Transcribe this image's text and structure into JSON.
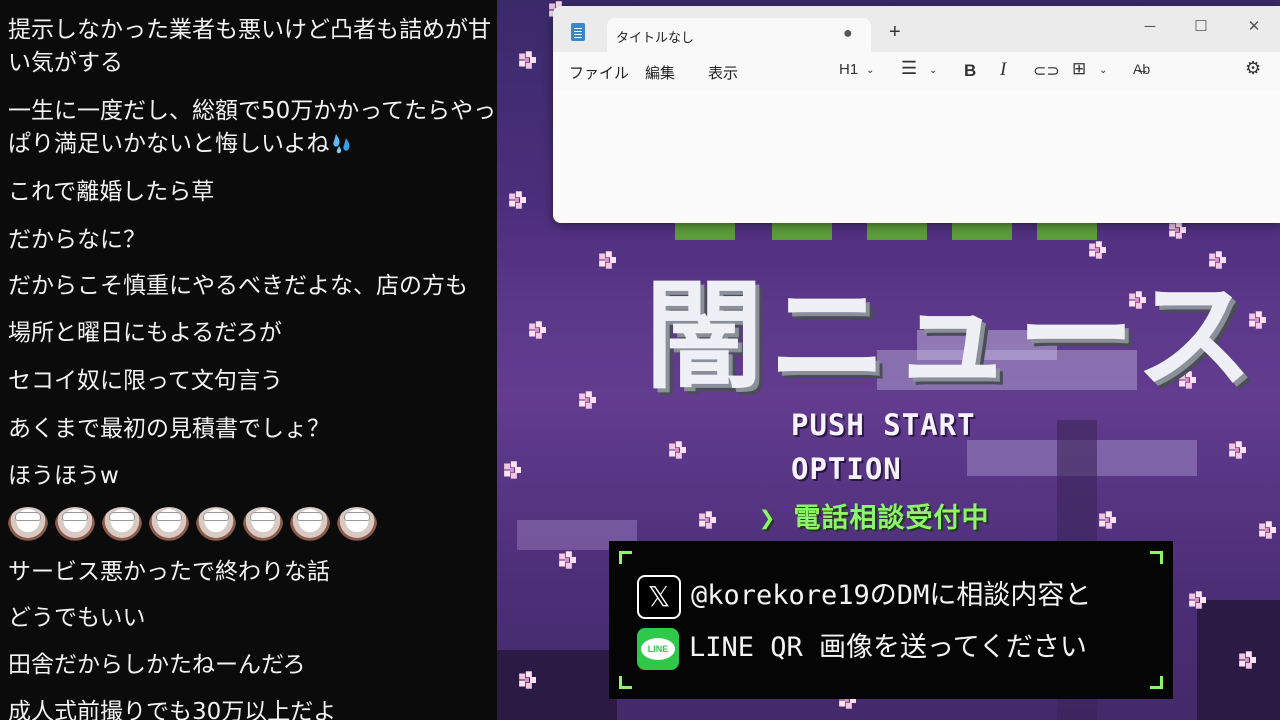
{
  "chat": {
    "messages": [
      "提示しなかった業者も悪いけど凸者も詰めが甘い気がする",
      "一生に一度だし、総額で50万かかってたらやっぱり満足いかないと悔しいよね",
      "これで離婚したら草",
      "だからなに？",
      "だからこそ慎重にやるべきだよな、店の方も",
      "場所と曜日にもよるだろが",
      "セコイ奴に限って文句言う",
      "あくまで最初の見積書でしょ？",
      "ほうほうw",
      "サービス悪かったで終わりな話",
      "どうでもいい",
      "田舎だからしかたねーんだろ",
      "成人式前撮りでも30万以上だよ"
    ],
    "stamp_count": 8,
    "stamp_icon": "emote-stamp-icon",
    "sweat_icon": "sweat-drops-icon"
  },
  "game": {
    "title": "闇ニュース",
    "menu": {
      "push_start": "PUSH START",
      "option": "OPTION",
      "selected": "電話相談受付中",
      "cursor": "❯"
    },
    "info": {
      "x_handle_line": "@korekore19のDMに相談内容と",
      "line_line": "LINE QR 画像を送ってください",
      "x_icon": "𝕏",
      "line_icon": "LINE"
    },
    "colors": {
      "accent": "#8ef56a",
      "bg": "#4d2f7d"
    }
  },
  "notepad": {
    "tab_title": "タイトルなし",
    "unsaved_dot": "●",
    "new_tab": "+",
    "window_buttons": {
      "minimize": "─",
      "maximize": "☐",
      "close": "✕"
    },
    "menu": {
      "file": "ファイル",
      "edit": "編集",
      "view": "表示"
    },
    "toolbar": {
      "heading": "H1",
      "chevron": "⌄",
      "list": "☰",
      "bold": "B",
      "italic": "I",
      "link": "⊂⊃",
      "table": "⊞",
      "spell": "A̶b",
      "settings": "⚙"
    },
    "content": ""
  }
}
